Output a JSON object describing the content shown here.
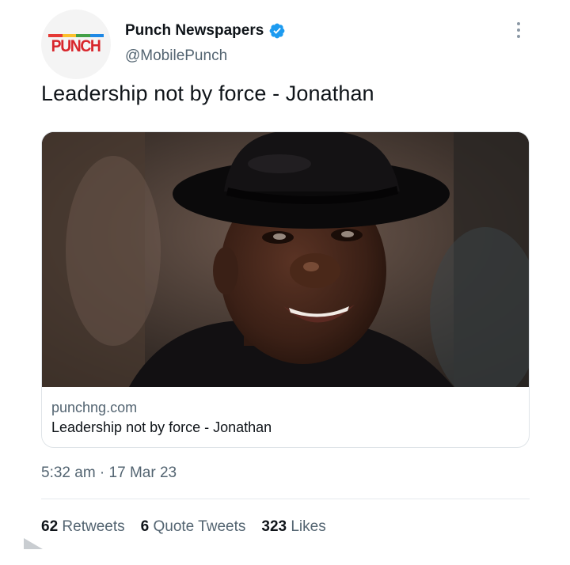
{
  "author": {
    "avatar_logo_text": "PUNCH",
    "display_name": "Punch Newspapers",
    "verified": true,
    "handle": "@MobilePunch"
  },
  "icons": {
    "more": "more-options-icon",
    "verified": "verified-badge-icon"
  },
  "tweet": {
    "text": "Leadership not by force - Jonathan"
  },
  "card": {
    "domain": "punchng.com",
    "title": "Leadership not by force - Jonathan",
    "image_alt": "Photo of a man in a black fedora hat smiling"
  },
  "meta": {
    "timestamp": "5:32 am · 17 Mar 23"
  },
  "stats": [
    {
      "count": "62",
      "label": "Retweets"
    },
    {
      "count": "6",
      "label": "Quote Tweets"
    },
    {
      "count": "323",
      "label": "Likes"
    }
  ],
  "colors": {
    "text": "#0f1419",
    "secondary": "#536471",
    "verified_blue": "#1d9bf0",
    "brand_red": "#d8262c"
  }
}
